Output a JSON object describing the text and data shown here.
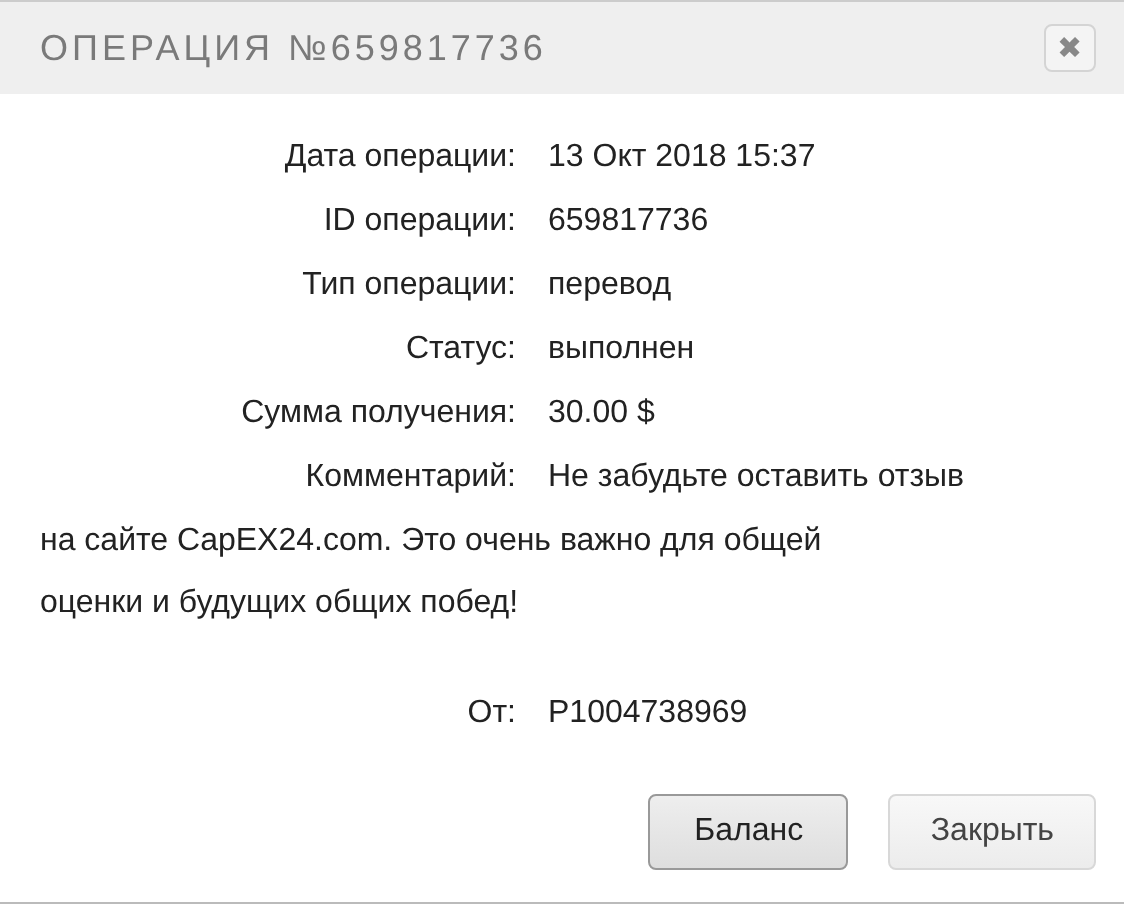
{
  "dialog": {
    "title": "ОПЕРАЦИЯ №659817736",
    "close_icon": "✖"
  },
  "rows": [
    {
      "kind": "line",
      "label": "Дата операции:",
      "value": "13 Окт 2018 15:37"
    },
    {
      "kind": "line",
      "label": "ID операции:",
      "value": "659817736"
    },
    {
      "kind": "line",
      "label": "Тип операции:",
      "value": "перевод"
    },
    {
      "kind": "line",
      "label": "Статус:",
      "value": "выполнен"
    },
    {
      "kind": "line",
      "label": "Сумма получения:",
      "value": "30.00 $"
    },
    {
      "kind": "wrap",
      "label": "Комментарий:",
      "lines": [
        "Не забудьте оставить отзыв",
        "на сайте CapEX24.com. Это очень важно для общей",
        "оценки и будущих общих побед!"
      ]
    },
    {
      "kind": "gap",
      "label": "От:",
      "value": "P1004738969"
    }
  ],
  "buttons": [
    {
      "label": "Баланс",
      "default": true
    },
    {
      "label": "Закрыть",
      "default": false
    }
  ]
}
